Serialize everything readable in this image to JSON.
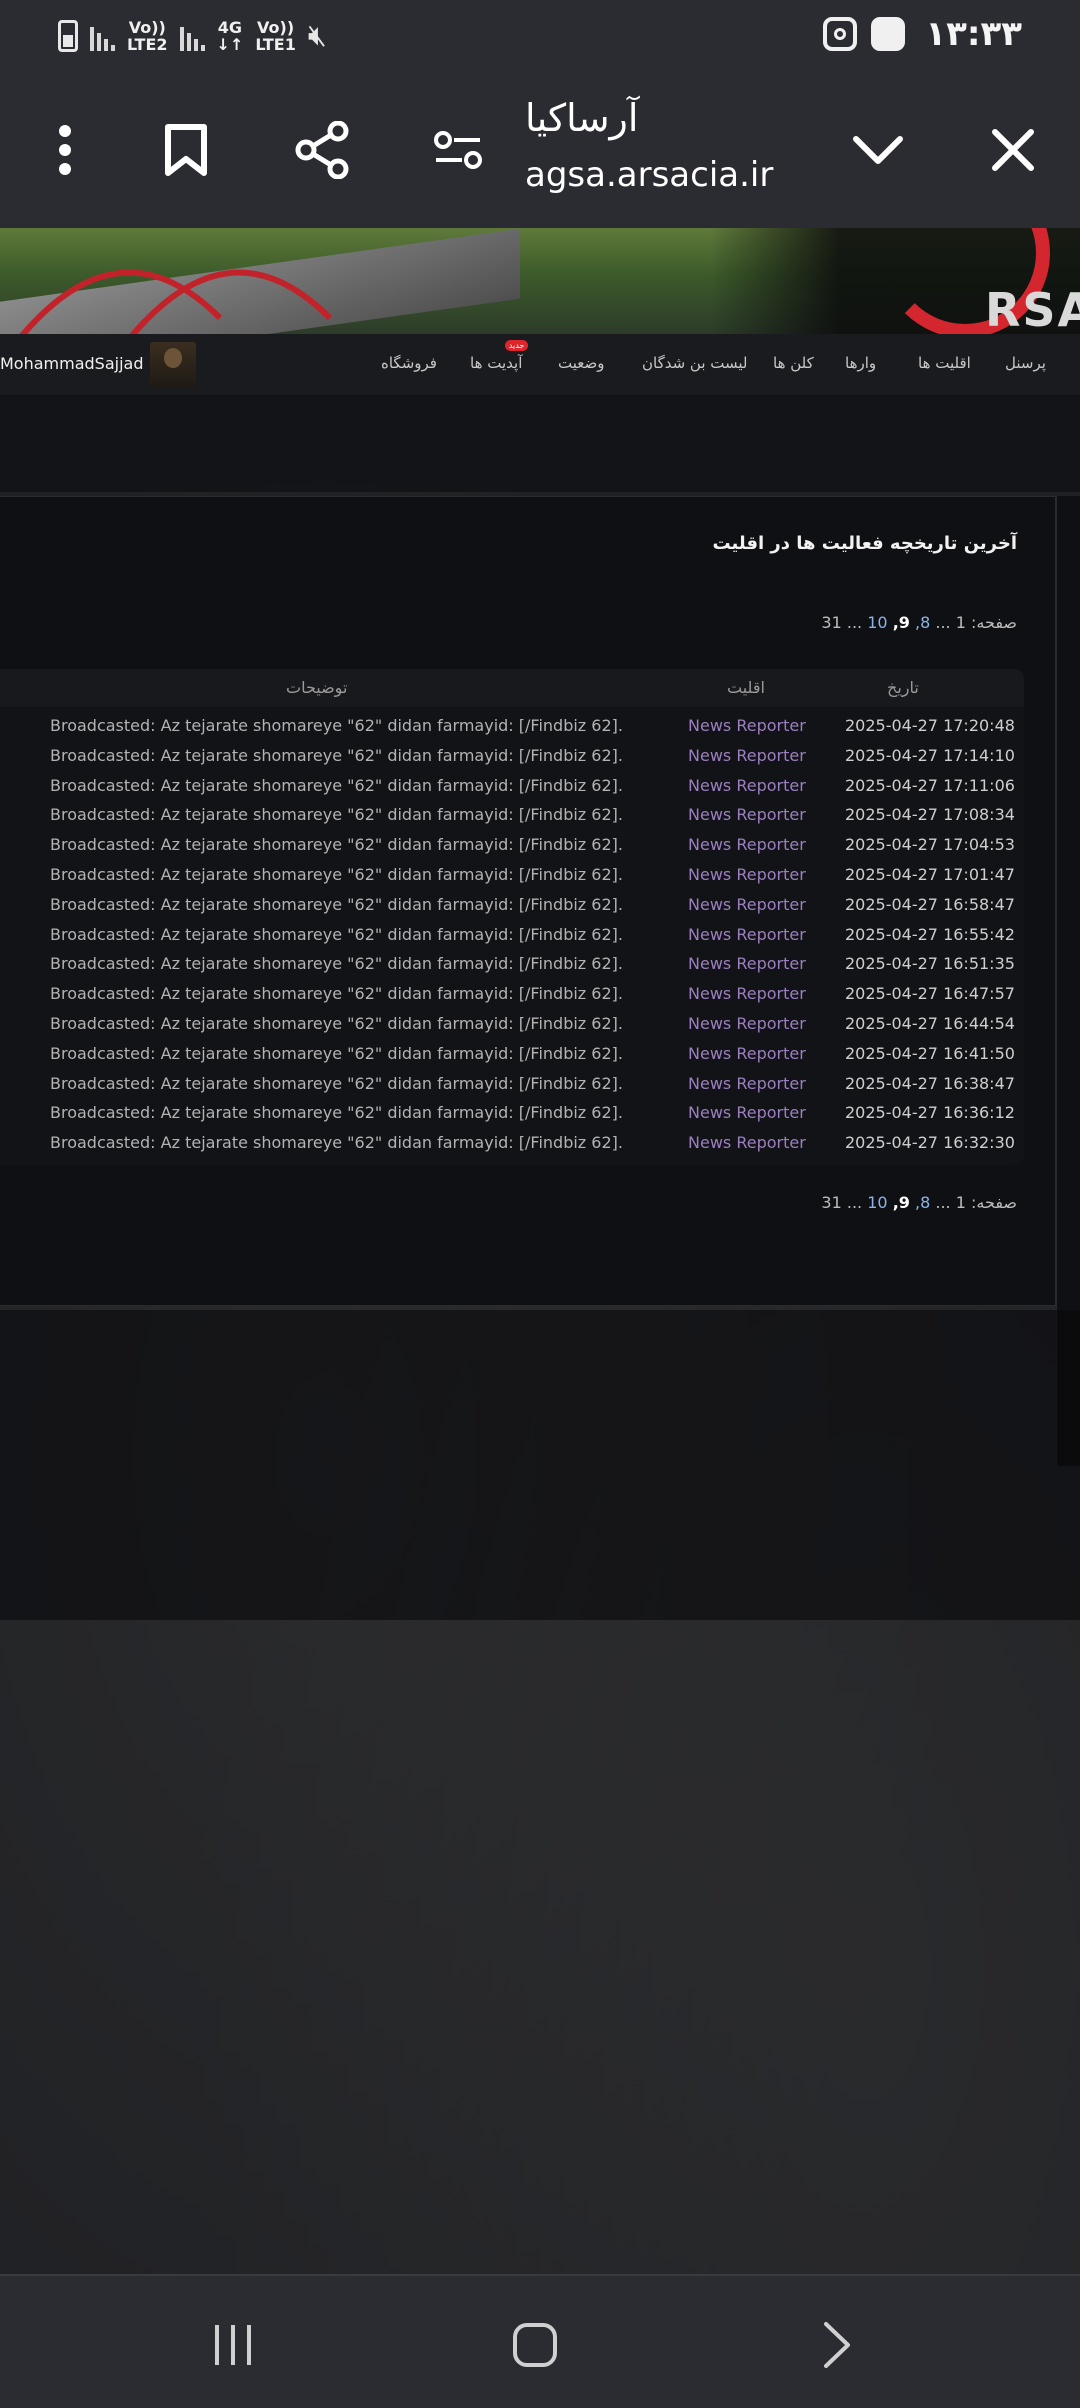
{
  "status_bar": {
    "time": "۱۳:۳۳",
    "net1_top": "Vo))",
    "net1_bottom": "LTE2",
    "net2_top": "4G",
    "net2_bottom": "↓↑",
    "net3_top": "Vo))",
    "net3_bottom": "LTE1"
  },
  "browser": {
    "page_title": "آرساکیا",
    "url": "agsa.arsacia.ir"
  },
  "site": {
    "logo_text": "RSA",
    "nav": {
      "items": [
        "پرسنل",
        "اقلیت ها",
        "وارها",
        "کلن ها",
        "لیست بن شدگان",
        "وضعیت",
        "آپدیت ها",
        "فروشگاه"
      ],
      "new_badge": "جدید",
      "username": "MohammadSajjad"
    },
    "panel": {
      "title": "آخرین تاریخچه فعالیت ها در اقلیت",
      "pager": {
        "label": "صفحه:",
        "first": "1",
        "ellipsis1": "...",
        "p8": "8,",
        "p9": "9,",
        "p10": "10",
        "ellipsis2": "...",
        "last": "31"
      },
      "columns": {
        "date": "تاریخ",
        "faction": "اقلیت",
        "description": "توضیحات"
      },
      "rows": [
        {
          "date": "2025-04-27 17:20:48",
          "faction": "News Reporter",
          "description": "Broadcasted: Az tejarate shomareye \"62\" didan farmayid: [/Findbiz 62]."
        },
        {
          "date": "2025-04-27 17:14:10",
          "faction": "News Reporter",
          "description": "Broadcasted: Az tejarate shomareye \"62\" didan farmayid: [/Findbiz 62]."
        },
        {
          "date": "2025-04-27 17:11:06",
          "faction": "News Reporter",
          "description": "Broadcasted: Az tejarate shomareye \"62\" didan farmayid: [/Findbiz 62]."
        },
        {
          "date": "2025-04-27 17:08:34",
          "faction": "News Reporter",
          "description": "Broadcasted: Az tejarate shomareye \"62\" didan farmayid: [/Findbiz 62]."
        },
        {
          "date": "2025-04-27 17:04:53",
          "faction": "News Reporter",
          "description": "Broadcasted: Az tejarate shomareye \"62\" didan farmayid: [/Findbiz 62]."
        },
        {
          "date": "2025-04-27 17:01:47",
          "faction": "News Reporter",
          "description": "Broadcasted: Az tejarate shomareye \"62\" didan farmayid: [/Findbiz 62]."
        },
        {
          "date": "2025-04-27 16:58:47",
          "faction": "News Reporter",
          "description": "Broadcasted: Az tejarate shomareye \"62\" didan farmayid: [/Findbiz 62]."
        },
        {
          "date": "2025-04-27 16:55:42",
          "faction": "News Reporter",
          "description": "Broadcasted: Az tejarate shomareye \"62\" didan farmayid: [/Findbiz 62]."
        },
        {
          "date": "2025-04-27 16:51:35",
          "faction": "News Reporter",
          "description": "Broadcasted: Az tejarate shomareye \"62\" didan farmayid: [/Findbiz 62]."
        },
        {
          "date": "2025-04-27 16:47:57",
          "faction": "News Reporter",
          "description": "Broadcasted: Az tejarate shomareye \"62\" didan farmayid: [/Findbiz 62]."
        },
        {
          "date": "2025-04-27 16:44:54",
          "faction": "News Reporter",
          "description": "Broadcasted: Az tejarate shomareye \"62\" didan farmayid: [/Findbiz 62]."
        },
        {
          "date": "2025-04-27 16:41:50",
          "faction": "News Reporter",
          "description": "Broadcasted: Az tejarate shomareye \"62\" didan farmayid: [/Findbiz 62]."
        },
        {
          "date": "2025-04-27 16:38:47",
          "faction": "News Reporter",
          "description": "Broadcasted: Az tejarate shomareye \"62\" didan farmayid: [/Findbiz 62]."
        },
        {
          "date": "2025-04-27 16:36:12",
          "faction": "News Reporter",
          "description": "Broadcasted: Az tejarate shomareye \"62\" didan farmayid: [/Findbiz 62]."
        },
        {
          "date": "2025-04-27 16:32:30",
          "faction": "News Reporter",
          "description": "Broadcasted: Az tejarate shomareye \"62\" didan farmayid: [/Findbiz 62]."
        }
      ]
    }
  },
  "colors": {
    "faction_link": "#9c7fc0",
    "pager_link": "#8cb4e6",
    "accent_red": "#d4262e"
  }
}
